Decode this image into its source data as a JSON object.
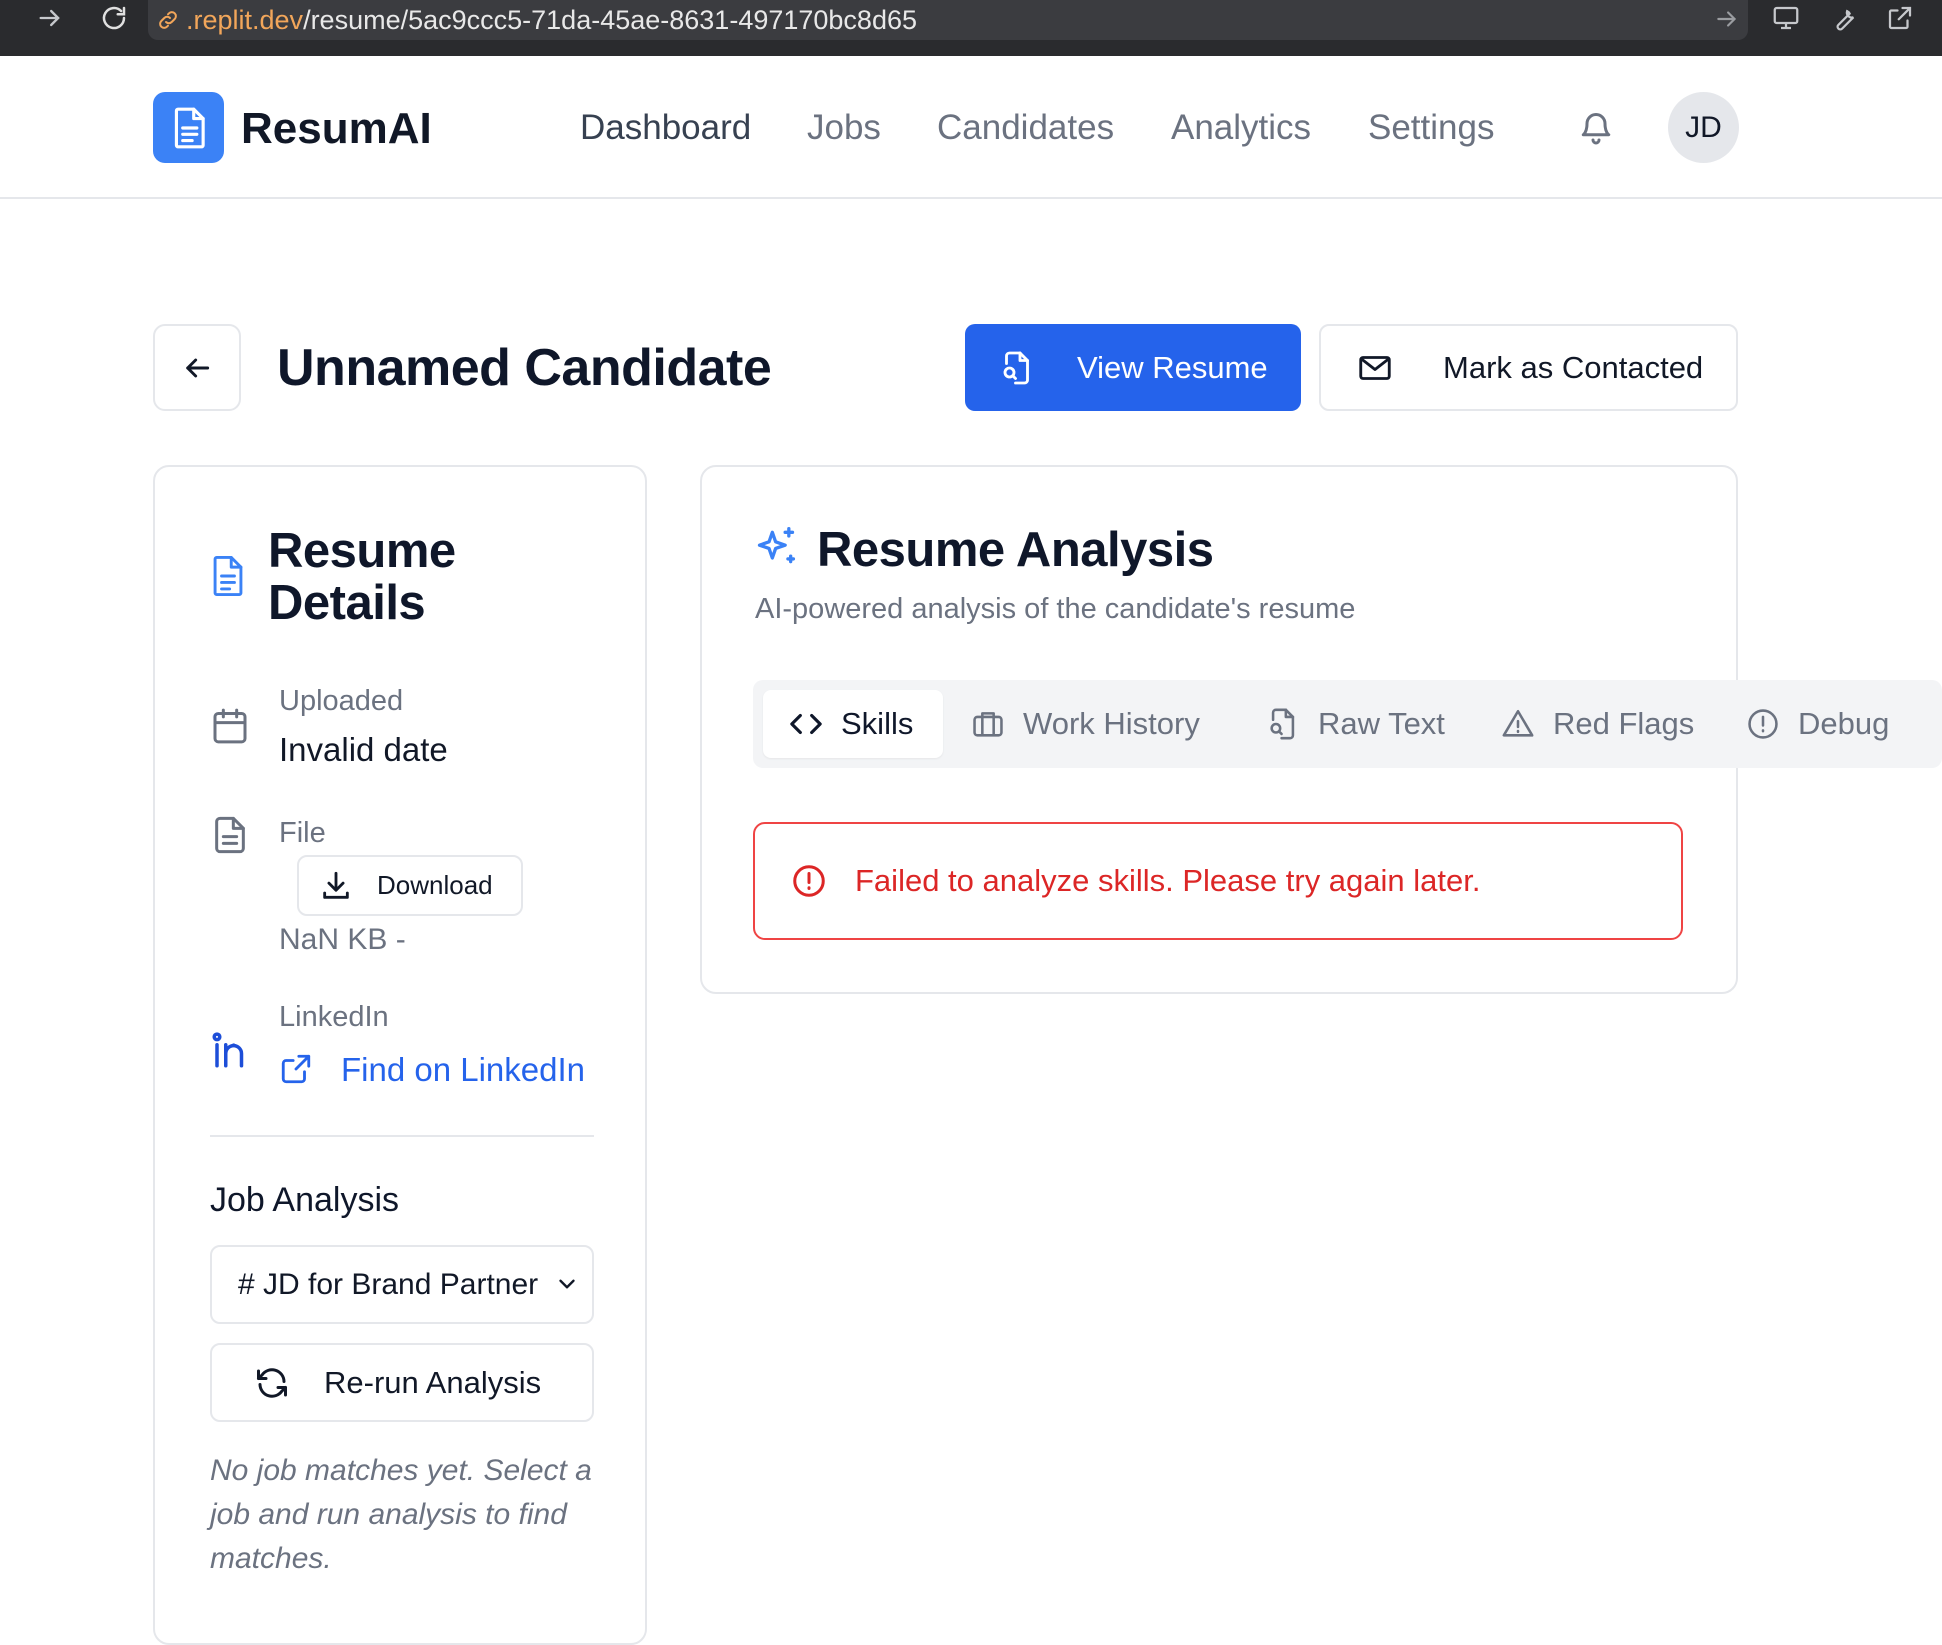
{
  "browser": {
    "url_host": ".replit.dev",
    "url_path": "/resume/5ac9ccc5-71da-45ae-8631-497170bc8d65"
  },
  "app": {
    "logo_text": "ResumAI",
    "nav": [
      "Dashboard",
      "Jobs",
      "Candidates",
      "Analytics",
      "Settings"
    ],
    "active_nav": "Dashboard",
    "avatar_initials": "JD"
  },
  "page": {
    "title": "Unnamed Candidate",
    "view_resume_label": "View Resume",
    "mark_contacted_label": "Mark as Contacted"
  },
  "resume_details": {
    "title": "Resume Details",
    "uploaded_label": "Uploaded",
    "uploaded_value": "Invalid date",
    "file_label": "File",
    "download_label": "Download",
    "file_size": "NaN KB -",
    "linkedin_label": "LinkedIn",
    "linkedin_link": "Find on LinkedIn",
    "job_analysis_title": "Job Analysis",
    "job_select_value": "# JD for Brand Partner",
    "rerun_label": "Re-run Analysis",
    "no_matches_note": "No job matches yet. Select a job and run analysis to find matches."
  },
  "analysis": {
    "title": "Resume Analysis",
    "subtitle": "AI-powered analysis of the candidate's resume",
    "tabs": [
      "Skills",
      "Work History",
      "Raw Text",
      "Red Flags",
      "Debug"
    ],
    "active_tab": "Skills",
    "error_message": "Failed to analyze skills. Please try again later."
  },
  "colors": {
    "primary": "#2563eb",
    "logo_bg": "#3b82f6",
    "error": "#dc2626",
    "linkedin_icon": "#1d4ed8"
  }
}
